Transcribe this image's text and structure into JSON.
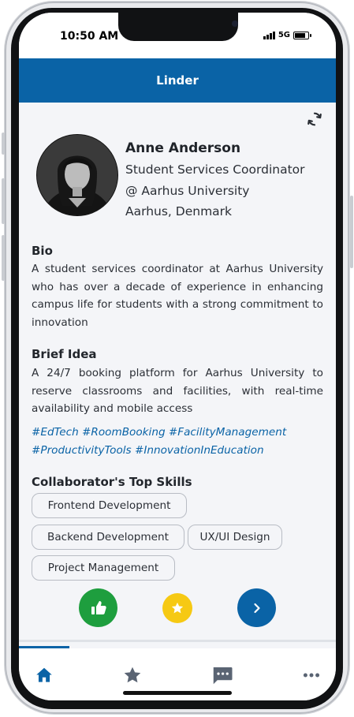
{
  "status_bar": {
    "time": "10:50 AM",
    "network": "5G"
  },
  "header": {
    "title": "Linder"
  },
  "profile": {
    "name": "Anne Anderson",
    "role": "Student Services Coordinator",
    "organization": "@ Aarhus University",
    "location": "Aarhus, Denmark"
  },
  "bio": {
    "title": "Bio",
    "text": "A student services coordinator at Aarhus University who has over a decade of experience in enhancing campus life for students with a strong commitment to innovation"
  },
  "idea": {
    "title": "Brief Idea",
    "text": "A 24/7 booking platform for Aarhus University to reserve classrooms and facilities, with real-time availability and mobile access",
    "hashtags": "#EdTech #RoomBooking #FacilityManagement #ProductivityTools #InnovationInEducation"
  },
  "skills": {
    "title": "Collaborator's Top Skills",
    "items": [
      "Frontend Development",
      "Backend Development",
      "UX/UI Design",
      "Project Management"
    ]
  },
  "actions": {
    "like_color": "#1e9e3e",
    "favorite_color": "#f6c913",
    "next_color": "#0a63a6"
  },
  "bottom_nav": {
    "items": [
      "home-icon",
      "star-icon",
      "chat-icon",
      "more-icon"
    ],
    "active": "home-icon"
  },
  "colors": {
    "primary": "#0a63a6",
    "background": "#f4f5f8"
  }
}
